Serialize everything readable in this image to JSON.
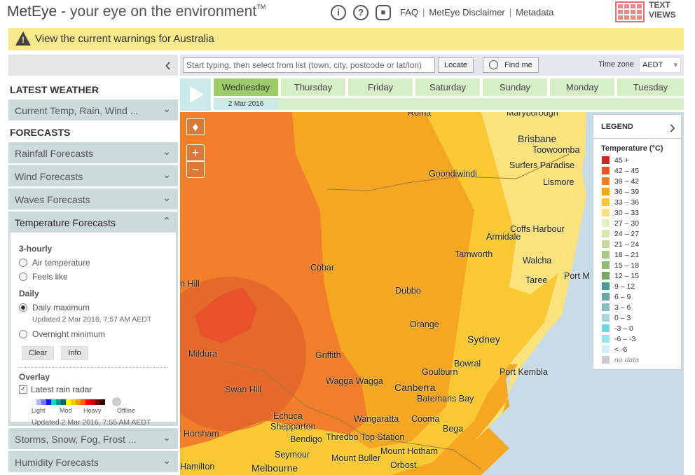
{
  "header": {
    "brand_main": "MetEye -",
    "brand_tag": "your eye on the environment",
    "brand_tm": "TM",
    "links": [
      "FAQ",
      "MetEye Disclaimer",
      "Metadata"
    ],
    "sep": "|",
    "text_views_line1": "TEXT",
    "text_views_line2": "VIEWS"
  },
  "warning": {
    "text": "View the current warnings for Australia"
  },
  "sidebar": {
    "latest_title": "LATEST WEATHER",
    "current_item": "Current Temp, Rain, Wind ...",
    "forecasts_title": "FORECASTS",
    "items": [
      "Rainfall Forecasts",
      "Wind Forecasts",
      "Waves Forecasts"
    ],
    "temp_title": "Temperature Forecasts",
    "bottom_items": [
      "Storms, Snow, Fog, Frost ...",
      "Humidity Forecasts"
    ],
    "temp": {
      "hourly_title": "3-hourly",
      "air": "Air temperature",
      "feels": "Feels like",
      "daily_title": "Daily",
      "daily_max": "Daily maximum",
      "daily_updated": "Updated 2 Mar 2016, 7:57 AM AEDT",
      "overnight": "Overnight minimum",
      "clear": "Clear",
      "info": "Info",
      "overlay_title": "Overlay",
      "radar": "Latest rain radar",
      "light": "Light",
      "mod": "Mod",
      "heavy": "Heavy",
      "offline": "Offline",
      "radar_updated": "Updated 2 Mar 2016, 7:55 AM AEDT"
    }
  },
  "toolbar": {
    "search_placeholder": "Start typing, then select from list (town, city, postcode or lat/lon)",
    "locate": "Locate",
    "find_me": "Find me",
    "tz_label": "Time zone",
    "tz_value": "AEDT"
  },
  "days": {
    "labels": [
      "Wednesday",
      "Thursday",
      "Friday",
      "Saturday",
      "Sunday",
      "Monday",
      "Tuesday"
    ],
    "selected_date": "2 Mar 2016"
  },
  "map": {
    "places": [
      "Brisbane",
      "Toowoomba",
      "Surfers Paradise",
      "Goondiwindi",
      "Lismore",
      "Coffs Harbour",
      "Armidale",
      "Tamworth",
      "Walcha",
      "Port M",
      "Taree",
      "Cobar",
      "Dubbo",
      "Orange",
      "Sydney",
      "Bowral",
      "Goulburn",
      "Port Kembla",
      "Canberra",
      "Batemans Bay",
      "Cooma",
      "Bega",
      "Wagga Wagga",
      "Griffith",
      "Mildura",
      "Swan Hill",
      "Echuca",
      "Shepparton",
      "Wangaratta",
      "Bendigo",
      "Thredbo Top Station",
      "Mount Hotham",
      "Mount Buller",
      "Orbost",
      "Seymour",
      "Melbourne",
      "Horsham",
      "Hamilton",
      "n Hill",
      "Roma",
      "Maryborough"
    ]
  },
  "legend": {
    "header": "LEGEND",
    "title": "Temperature (°C)",
    "rows": [
      {
        "label": "45 +",
        "color": "#c42a22"
      },
      {
        "label": "42 – 45",
        "color": "#e8522c"
      },
      {
        "label": "39 – 42",
        "color": "#f07e2a"
      },
      {
        "label": "36 – 39",
        "color": "#f5a623"
      },
      {
        "label": "33 – 36",
        "color": "#f8c935"
      },
      {
        "label": "30 – 33",
        "color": "#fbe27c"
      },
      {
        "label": "27 – 30",
        "color": "#e8eec0"
      },
      {
        "label": "24 – 27",
        "color": "#d8e6b4"
      },
      {
        "label": "21 – 24",
        "color": "#c4d8a0"
      },
      {
        "label": "18 – 21",
        "color": "#a8c888"
      },
      {
        "label": "15 – 18",
        "color": "#90b878"
      },
      {
        "label": "12 – 15",
        "color": "#78a868"
      },
      {
        "label": "9 – 12",
        "color": "#4e9a90"
      },
      {
        "label": "6 – 9",
        "color": "#6aa8a8"
      },
      {
        "label": "3 – 6",
        "color": "#8cbcc0"
      },
      {
        "label": "0 – 3",
        "color": "#a8d8dc"
      },
      {
        "label": "-3 – 0",
        "color": "#6ed8e0"
      },
      {
        "label": "-6 – -3",
        "color": "#98e4ea"
      },
      {
        "label": "< -6",
        "color": "#d0f0f4"
      },
      {
        "label": "no data",
        "color": "#cccccc"
      }
    ]
  }
}
